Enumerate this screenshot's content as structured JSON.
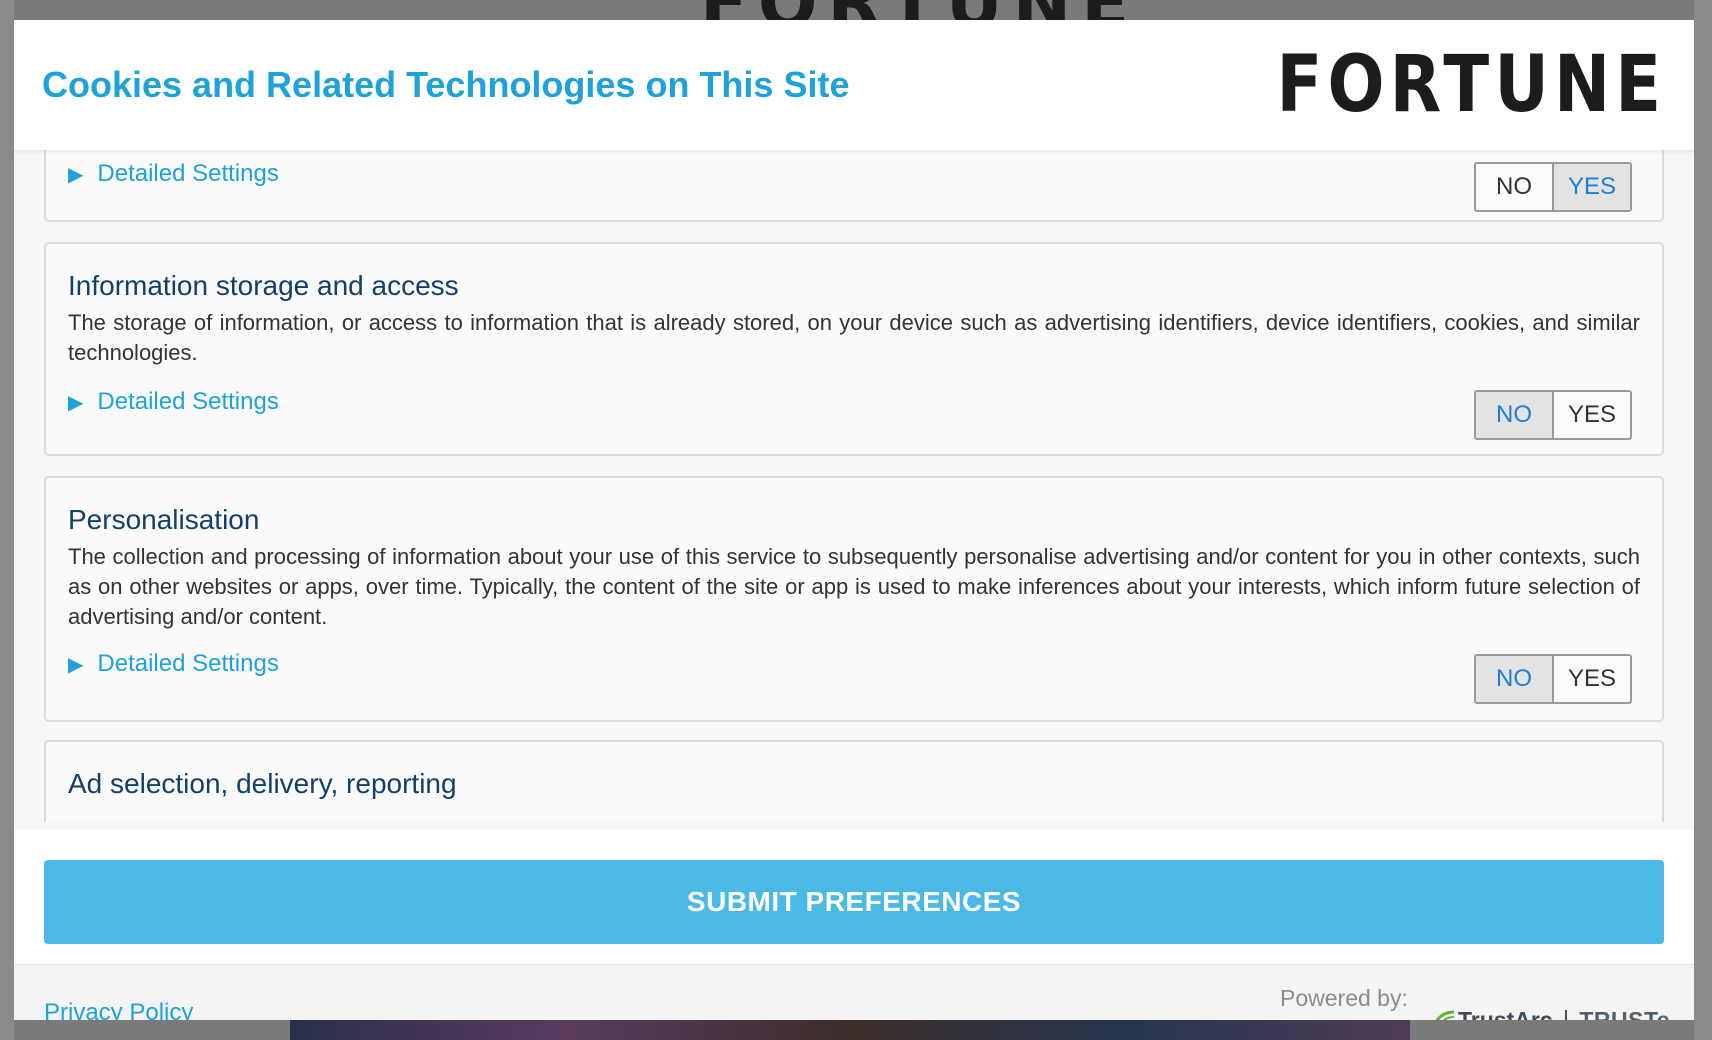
{
  "background": {
    "logo_text": "FORTUNE"
  },
  "header": {
    "title": "Cookies and Related Technologies on This Site",
    "logo": "FORTUNE"
  },
  "cards": [
    {
      "title": "",
      "description": "",
      "details_label": "Detailed Settings",
      "toggle": {
        "no_label": "NO",
        "yes_label": "YES",
        "selected": "YES"
      }
    },
    {
      "title": "Information storage and access",
      "description": "The storage of information, or access to information that is already stored, on your device such as advertising identifiers, device identifiers, cookies, and similar technologies.",
      "details_label": "Detailed Settings",
      "toggle": {
        "no_label": "NO",
        "yes_label": "YES",
        "selected": "NO"
      }
    },
    {
      "title": "Personalisation",
      "description": "The collection and processing of information about your use of this service to subsequently personalise advertising and/or content for you in other contexts, such as on other websites or apps, over time. Typically, the content of the site or app is used to make inferences about your interests, which inform future selection of advertising and/or content.",
      "details_label": "Detailed Settings",
      "toggle": {
        "no_label": "NO",
        "yes_label": "YES",
        "selected": "NO"
      }
    },
    {
      "title": "Ad selection, delivery, reporting",
      "description": ""
    }
  ],
  "submit": {
    "label": "SUBMIT PREFERENCES"
  },
  "footer": {
    "privacy_label": "Privacy Policy",
    "powered_by": "Powered by:",
    "trustarc": "TrustArc",
    "separator": "|",
    "truste": "TRUSTe"
  },
  "colors": {
    "accent": "#1ea2d8",
    "submit_bg": "#4ab9e5",
    "title_dark": "#123f6b",
    "toggle_selected_text": "#1d7fd6"
  }
}
